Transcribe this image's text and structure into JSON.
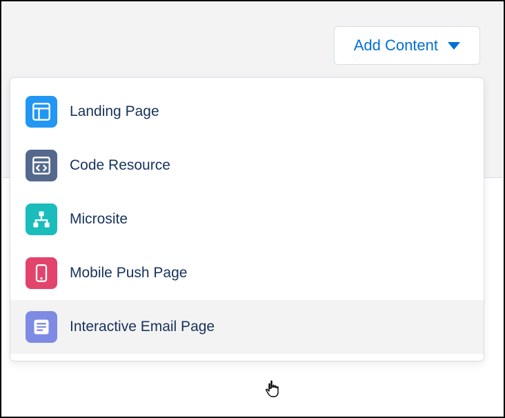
{
  "button": {
    "add_content_label": "Add Content"
  },
  "menu": {
    "items": [
      {
        "label": "Landing Page",
        "icon": "landing-page-icon",
        "color": "#2196f3"
      },
      {
        "label": "Code Resource",
        "icon": "code-resource-icon",
        "color": "#54698d"
      },
      {
        "label": "Microsite",
        "icon": "microsite-icon",
        "color": "#1abcbc"
      },
      {
        "label": "Mobile Push Page",
        "icon": "mobile-push-icon",
        "color": "#e2446c"
      },
      {
        "label": "Interactive Email Page",
        "icon": "interactive-email-icon",
        "color": "#7e8be4"
      }
    ],
    "hovered_index": 4
  }
}
